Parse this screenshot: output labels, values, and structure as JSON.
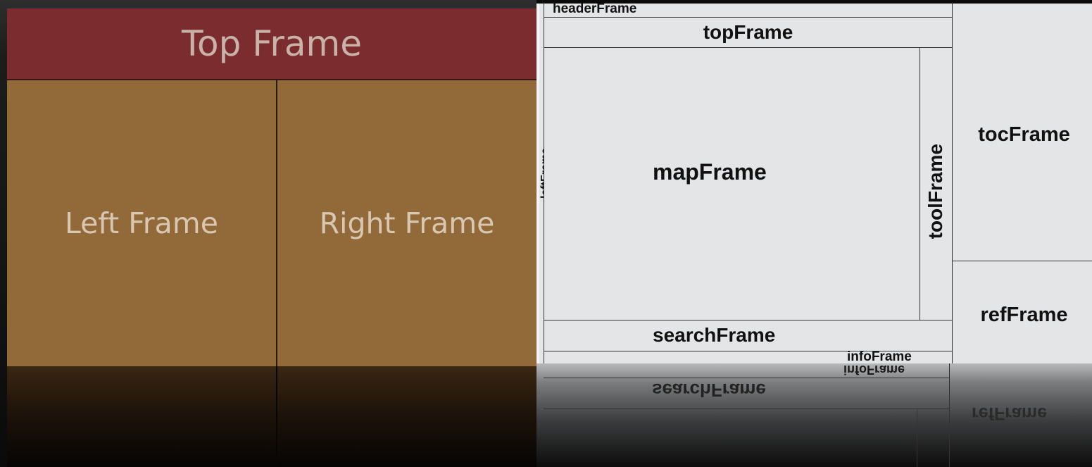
{
  "left_diagram": {
    "top_frame": "Top Frame",
    "left_frame": "Left Frame",
    "right_frame": "Right Frame"
  },
  "right_diagram": {
    "header_frame": "headerFrame",
    "top_frame": "topFrame",
    "left_frame": "leftFrame",
    "map_frame": "mapFrame",
    "tool_frame": "toolFrame",
    "toc_frame": "tocFrame",
    "ref_frame": "refFrame",
    "search_frame": "searchFrame",
    "info_frame": "infoFrame"
  },
  "colors": {
    "top_frame": "#7b2c2f",
    "side_frames": "#926a3a",
    "frame_background": "#e4e5e7"
  }
}
